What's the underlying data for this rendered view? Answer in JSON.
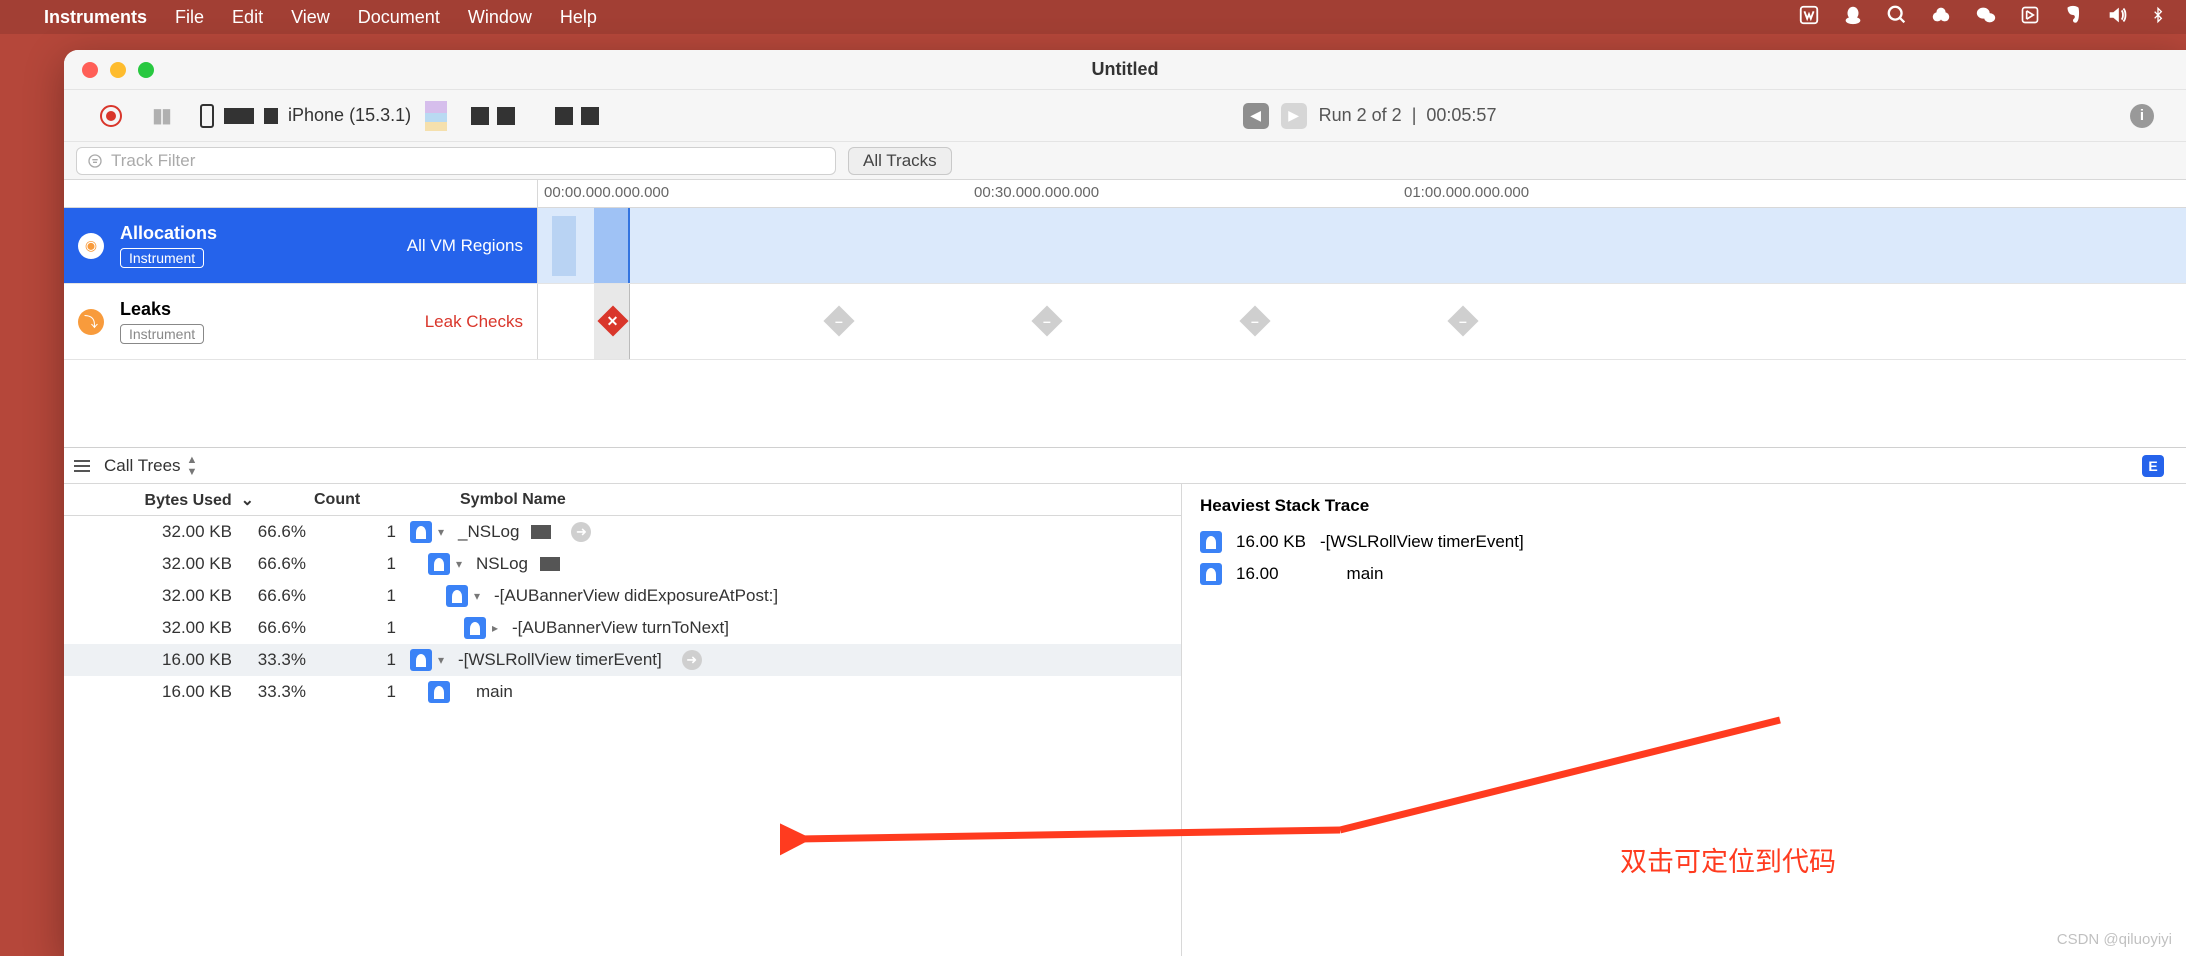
{
  "menubar": {
    "app": "Instruments",
    "items": [
      "File",
      "Edit",
      "View",
      "Document",
      "Window",
      "Help"
    ]
  },
  "window": {
    "title": "Untitled"
  },
  "toolbar": {
    "device": "iPhone (15.3.1)",
    "run_label": "Run 2 of 2",
    "time": "00:05:57"
  },
  "filter": {
    "placeholder": "Track Filter",
    "all_tracks": "All Tracks"
  },
  "ruler": {
    "t0": "00:00.000.000.000",
    "t1": "00:30.000.000.000",
    "t2": "01:00.000.000.000"
  },
  "tracks": {
    "alloc": {
      "name": "Allocations",
      "badge": "Instrument",
      "mode": "All VM Regions"
    },
    "leaks": {
      "name": "Leaks",
      "badge": "Instrument",
      "mode": "Leak Checks"
    }
  },
  "detail": {
    "picker": "Call Trees",
    "cols": {
      "bytes": "Bytes Used",
      "count": "Count",
      "symbol": "Symbol Name"
    },
    "rows": [
      {
        "bytes": "32.00 KB",
        "pct": "66.6%",
        "count": "1",
        "indent": 0,
        "disc": "▾",
        "symbol": "_NSLog"
      },
      {
        "bytes": "32.00 KB",
        "pct": "66.6%",
        "count": "1",
        "indent": 1,
        "disc": "▾",
        "symbol": "NSLog"
      },
      {
        "bytes": "32.00 KB",
        "pct": "66.6%",
        "count": "1",
        "indent": 2,
        "disc": "▾",
        "symbol": "-[AUBannerView didExposureAtPost:]"
      },
      {
        "bytes": "32.00 KB",
        "pct": "66.6%",
        "count": "1",
        "indent": 3,
        "disc": "▸",
        "symbol": "-[AUBannerView turnToNext]"
      },
      {
        "bytes": "16.00 KB",
        "pct": "33.3%",
        "count": "1",
        "indent": 0,
        "disc": "▾",
        "symbol": "-[WSLRollView timerEvent]",
        "sel": true
      },
      {
        "bytes": "16.00 KB",
        "pct": "33.3%",
        "count": "1",
        "indent": 1,
        "disc": "",
        "symbol": "main"
      }
    ],
    "stack": {
      "title": "Heaviest Stack Trace",
      "rows": [
        {
          "bytes": "16.00 KB",
          "symbol": "-[WSLRollView timerEvent]"
        },
        {
          "bytes": "16.00",
          "symbol": "main"
        }
      ]
    },
    "e_badge": "E"
  },
  "annotation": "双击可定位到代码",
  "watermark": "CSDN @qiluoyiyi"
}
